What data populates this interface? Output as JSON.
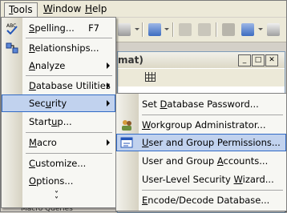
{
  "menubar": {
    "tools": {
      "label": "Tools",
      "u": "T",
      "rest": "ools"
    },
    "window": {
      "label": "Window",
      "u": "W",
      "rest": "indow"
    },
    "help": {
      "label": "Help",
      "u": "H",
      "rest": "elp"
    }
  },
  "db_window": {
    "title_fragment": "mat)"
  },
  "bottom_fragment": "Macro Queries",
  "tools_menu": {
    "items": [
      {
        "label": "Spelling...",
        "u": "S",
        "rest": "pelling...",
        "shortcut": "F7",
        "icon": "spelling-abc-icon"
      },
      {
        "label": "Relationships...",
        "pre": "",
        "u": "R",
        "rest": "elationships...",
        "icon": "relationships-icon"
      },
      {
        "label": "Analyze",
        "pre": "",
        "u": "A",
        "rest": "nalyze"
      },
      {
        "label": "Database Utilities",
        "pre": "",
        "u": "D",
        "rest": "atabase Utilities"
      },
      {
        "label": "Security",
        "pre": "Sec",
        "u": "u",
        "rest": "rity"
      },
      {
        "label": "Startup...",
        "pre": "Start",
        "u": "u",
        "rest": "p..."
      },
      {
        "label": "Macro",
        "pre": "",
        "u": "M",
        "rest": "acro"
      },
      {
        "label": "Customize...",
        "pre": "",
        "u": "C",
        "rest": "ustomize..."
      },
      {
        "label": "Options...",
        "pre": "",
        "u": "O",
        "rest": "ptions..."
      }
    ],
    "expand_glyph": "»"
  },
  "security_menu": {
    "items": [
      {
        "label": "Set Database Password...",
        "pre": "Set ",
        "u": "D",
        "rest": "atabase Password..."
      },
      {
        "label": "Workgroup Administrator...",
        "pre": "",
        "u": "W",
        "rest": "orkgroup Administrator...",
        "icon": "workgroup-admin-icon"
      },
      {
        "label": "User and Group Permissions...",
        "pre": "",
        "u": "U",
        "rest": "ser and Group Permissions...",
        "icon": "permissions-icon"
      },
      {
        "label": "User and Group Accounts...",
        "pre": "User and Group ",
        "u": "A",
        "rest": "ccounts..."
      },
      {
        "label": "User-Level Security Wizard...",
        "pre": "User-Level Security ",
        "u": "W",
        "rest": "izard..."
      },
      {
        "label": "Encode/Decode Database...",
        "pre": "",
        "u": "E",
        "rest": "ncode/Decode Database..."
      }
    ]
  },
  "colors": {
    "highlight": "#c1d2ee",
    "highlight_border": "#316ac5",
    "menu_bg": "#f7f7f3"
  }
}
